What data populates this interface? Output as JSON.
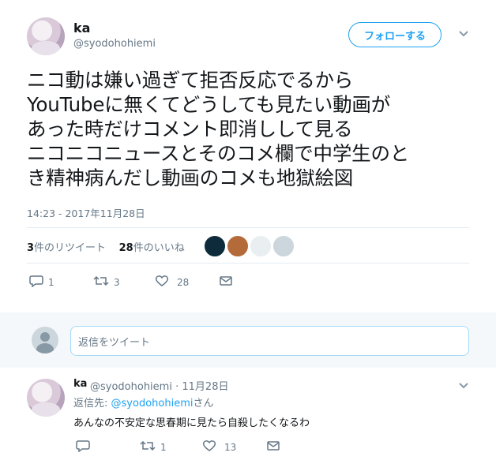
{
  "tweet": {
    "display_name": "ka",
    "handle": "@syodohohiemi",
    "follow_label": "フォローする",
    "text_lines": [
      "ニコ動は嫌い過ぎて拒否反応でるから",
      "YouTubeに無くてどうしても見たい動画が",
      "あった時だけコメント即消しして見る",
      "ニコニコニュースとそのコメ欄で中学生のと",
      "き精神病んだし動画のコメも地獄絵図"
    ],
    "timestamp": "14:23 - 2017年11月28日",
    "retweet_count": "3",
    "retweet_label": "件のリツイート",
    "like_count": "28",
    "like_label": "件のいいね",
    "actions": {
      "reply": "1",
      "retweet": "3",
      "like": "28"
    }
  },
  "reply_box": {
    "placeholder": "返信をツイート"
  },
  "reply": {
    "display_name": "ka",
    "handle": "@syodohohiemi",
    "separator": "·",
    "date": "11月28日",
    "reply_to_prefix": "返信先:",
    "reply_to_handle": "@syodohohiemi",
    "reply_to_suffix": "さん",
    "text": "あんなの不安定な思春期に見たら自殺したくなるわ",
    "actions": {
      "reply": "",
      "retweet": "1",
      "like": "13"
    }
  },
  "icons": {
    "caret": "chevron-down-icon",
    "reply": "reply-icon",
    "retweet": "retweet-icon",
    "like": "heart-icon",
    "dm": "envelope-icon"
  },
  "colors": {
    "accent": "#1da1f2",
    "muted": "#657786",
    "divider": "#e6ecf0"
  }
}
